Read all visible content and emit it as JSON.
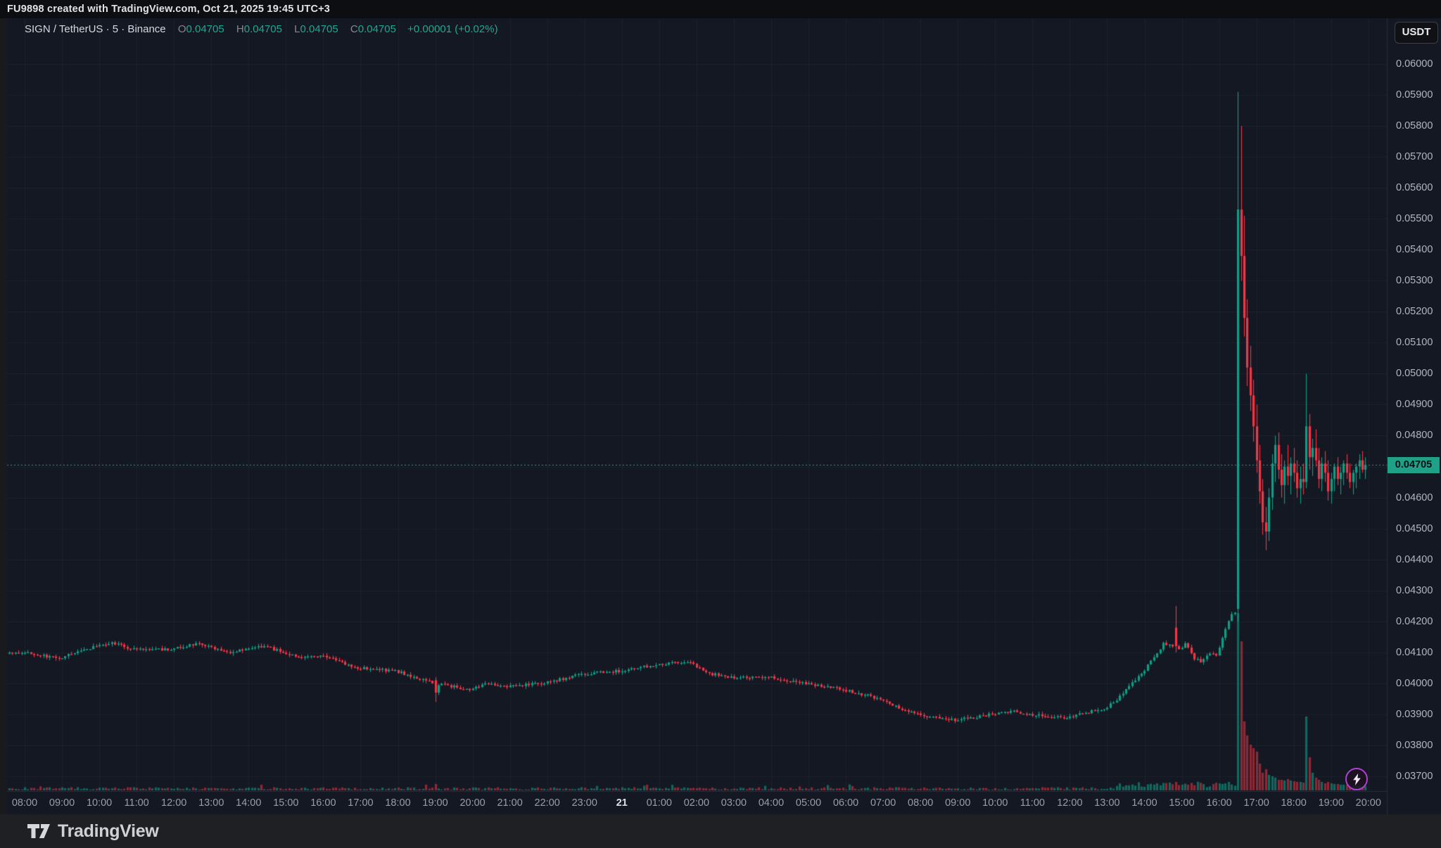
{
  "watermark_bar": {
    "text": "FU9898 created with TradingView.com, Oct 21, 2025 19:45 UTC+3"
  },
  "legend": {
    "title": "SIGN / TetherUS · 5 · Binance",
    "ohlc": [
      {
        "label": "O",
        "value": "0.04705"
      },
      {
        "label": "H",
        "value": "0.04705"
      },
      {
        "label": "L",
        "value": "0.04705"
      },
      {
        "label": "C",
        "value": "0.04705"
      }
    ],
    "change": "+0.00001 (+0.02%)"
  },
  "price_axis": {
    "currency_button": "USDT",
    "labels": [
      "0.06000",
      "0.05900",
      "0.05800",
      "0.05700",
      "0.05600",
      "0.05500",
      "0.05400",
      "0.05300",
      "0.05200",
      "0.05100",
      "0.05000",
      "0.04900",
      "0.04800",
      "0.04600",
      "0.04500",
      "0.04400",
      "0.04300",
      "0.04200",
      "0.04100",
      "0.04000",
      "0.03900",
      "0.03800",
      "0.03700"
    ],
    "last_price": "0.04705"
  },
  "time_axis": {
    "labels": [
      "08:00",
      "09:00",
      "10:00",
      "11:00",
      "12:00",
      "13:00",
      "14:00",
      "15:00",
      "16:00",
      "17:00",
      "18:00",
      "19:00",
      "20:00",
      "21:00",
      "22:00",
      "23:00",
      "21",
      "01:00",
      "02:00",
      "03:00",
      "04:00",
      "05:00",
      "06:00",
      "07:00",
      "08:00",
      "09:00",
      "10:00",
      "11:00",
      "12:00",
      "13:00",
      "14:00",
      "15:00",
      "16:00",
      "17:00",
      "18:00",
      "19:00",
      "20:00"
    ],
    "major_index": 16
  },
  "footer": {
    "brand": "TradingView"
  },
  "colors": {
    "background": "#141823",
    "grid": "rgba(170,182,205,0.055)",
    "up": "#0f9d84",
    "down": "#f23645",
    "vol_up": "rgba(16,154,132,0.62)",
    "vol_down": "rgba(242,54,69,0.55)",
    "last_price_line": "#1fa187",
    "pane_border": "#2a2e39"
  },
  "chart_data": {
    "type": "candlestick",
    "symbol": "SIGN / TetherUS",
    "exchange": "Binance",
    "interval_minutes": 5,
    "session_start_label": "08:00",
    "hours_span": 36,
    "price_min": 0.037,
    "price_max": 0.06,
    "price_step": 0.001,
    "last_price": 0.04705,
    "volume_overlay": true,
    "seed": 7,
    "path_anchors": [
      [
        -0.5,
        0.041
      ],
      [
        0,
        0.041
      ],
      [
        1,
        0.0408
      ],
      [
        1.5,
        0.041
      ],
      [
        2,
        0.0412
      ],
      [
        2.4,
        0.0413
      ],
      [
        3,
        0.0411
      ],
      [
        4,
        0.0411
      ],
      [
        4.7,
        0.0413
      ],
      [
        5.5,
        0.041
      ],
      [
        6,
        0.0411
      ],
      [
        6.5,
        0.0412
      ],
      [
        7.5,
        0.0408
      ],
      [
        8,
        0.0409
      ],
      [
        9,
        0.0405
      ],
      [
        10,
        0.0404
      ],
      [
        10.8,
        0.0401
      ],
      [
        11,
        0.04
      ],
      [
        11.5,
        0.0399
      ],
      [
        12,
        0.0398
      ],
      [
        12.5,
        0.04
      ],
      [
        13,
        0.0399
      ],
      [
        14,
        0.04
      ],
      [
        15,
        0.0403
      ],
      [
        16,
        0.0404
      ],
      [
        17,
        0.0406
      ],
      [
        17.8,
        0.0407
      ],
      [
        18.5,
        0.0403
      ],
      [
        19,
        0.0402
      ],
      [
        20,
        0.0402
      ],
      [
        21,
        0.04
      ],
      [
        22,
        0.0398
      ],
      [
        23,
        0.0395
      ],
      [
        23.5,
        0.0392
      ],
      [
        24,
        0.039
      ],
      [
        25,
        0.0388
      ],
      [
        26,
        0.039
      ],
      [
        26.5,
        0.0391
      ],
      [
        27,
        0.039
      ],
      [
        28,
        0.0389
      ],
      [
        29,
        0.0392
      ],
      [
        29.3,
        0.0394
      ],
      [
        29.7,
        0.04
      ],
      [
        30,
        0.0403
      ],
      [
        30.3,
        0.0408
      ],
      [
        30.6,
        0.0413
      ],
      [
        31,
        0.0411
      ],
      [
        31.2,
        0.0413
      ],
      [
        31.4,
        0.0408
      ],
      [
        31.6,
        0.0407
      ],
      [
        31.8,
        0.041
      ],
      [
        32,
        0.0409
      ],
      [
        32.15,
        0.0414
      ],
      [
        32.3,
        0.0419
      ],
      [
        32.46,
        0.0423
      ]
    ],
    "event_candles": [
      [
        11.0,
        0.0401,
        0.0402,
        0.0394,
        0.0397,
        9
      ],
      [
        30.83,
        0.0418,
        0.0425,
        0.041,
        0.0412,
        12
      ]
    ],
    "spike_start_hour": 32.5,
    "spike_candles": [
      [
        0.0424,
        0.0591,
        0.042,
        0.0553,
        252
      ],
      [
        0.0553,
        0.058,
        0.053,
        0.0538,
        212
      ],
      [
        0.0538,
        0.0551,
        0.0512,
        0.0518,
        98
      ],
      [
        0.0518,
        0.0524,
        0.0496,
        0.0502,
        78
      ],
      [
        0.0502,
        0.0509,
        0.0488,
        0.0493,
        65
      ],
      [
        0.0493,
        0.0498,
        0.0478,
        0.0483,
        60
      ],
      [
        0.0483,
        0.049,
        0.0468,
        0.0472,
        55
      ],
      [
        0.0472,
        0.0477,
        0.0458,
        0.0462,
        38
      ],
      [
        0.0462,
        0.0466,
        0.0448,
        0.0452,
        25
      ],
      [
        0.0452,
        0.0457,
        0.0443,
        0.0449,
        30
      ],
      [
        0.0449,
        0.0463,
        0.0446,
        0.046,
        22
      ],
      [
        0.046,
        0.0474,
        0.0456,
        0.0471,
        20
      ],
      [
        0.0471,
        0.048,
        0.0465,
        0.0477,
        18
      ],
      [
        0.0477,
        0.0481,
        0.0466,
        0.0469,
        15
      ],
      [
        0.0469,
        0.0474,
        0.046,
        0.0464,
        15
      ],
      [
        0.0464,
        0.0472,
        0.0458,
        0.047,
        14
      ],
      [
        0.047,
        0.0477,
        0.0464,
        0.0467,
        16
      ],
      [
        0.0467,
        0.0473,
        0.0461,
        0.0471,
        14
      ],
      [
        0.0471,
        0.0476,
        0.0465,
        0.0468,
        13
      ],
      [
        0.0468,
        0.0472,
        0.046,
        0.0463,
        12
      ],
      [
        0.0463,
        0.047,
        0.0458,
        0.0466,
        12
      ],
      [
        0.0466,
        0.0471,
        0.0461,
        0.0465,
        11
      ],
      [
        0.0465,
        0.05,
        0.0463,
        0.0483,
        105
      ],
      [
        0.0483,
        0.0487,
        0.0469,
        0.0473,
        47
      ],
      [
        0.0473,
        0.0479,
        0.0467,
        0.0476,
        25
      ],
      [
        0.0476,
        0.0482,
        0.047,
        0.0472,
        18
      ],
      [
        0.0472,
        0.0476,
        0.0463,
        0.0466,
        15
      ],
      [
        0.0466,
        0.0473,
        0.0462,
        0.0471,
        12
      ],
      [
        0.0471,
        0.0475,
        0.0465,
        0.0468,
        10
      ],
      [
        0.0468,
        0.0472,
        0.0459,
        0.0462,
        12
      ],
      [
        0.0462,
        0.0468,
        0.0458,
        0.0466,
        10
      ],
      [
        0.0466,
        0.0471,
        0.0462,
        0.047,
        9
      ],
      [
        0.047,
        0.0473,
        0.0464,
        0.0466,
        9
      ],
      [
        0.0466,
        0.047,
        0.0461,
        0.0468,
        8
      ],
      [
        0.0468,
        0.0472,
        0.0464,
        0.0471,
        8
      ],
      [
        0.0471,
        0.0474,
        0.0466,
        0.0468,
        8
      ],
      [
        0.0468,
        0.0471,
        0.0463,
        0.0465,
        7
      ],
      [
        0.0465,
        0.0469,
        0.0461,
        0.0468,
        7
      ],
      [
        0.0468,
        0.0471,
        0.0463,
        0.047,
        7
      ],
      [
        0.047,
        0.0474,
        0.0466,
        0.0472,
        7
      ],
      [
        0.0472,
        0.0475,
        0.0468,
        0.0469,
        6
      ],
      [
        0.0469,
        0.0473,
        0.0466,
        0.04705,
        6
      ]
    ]
  }
}
